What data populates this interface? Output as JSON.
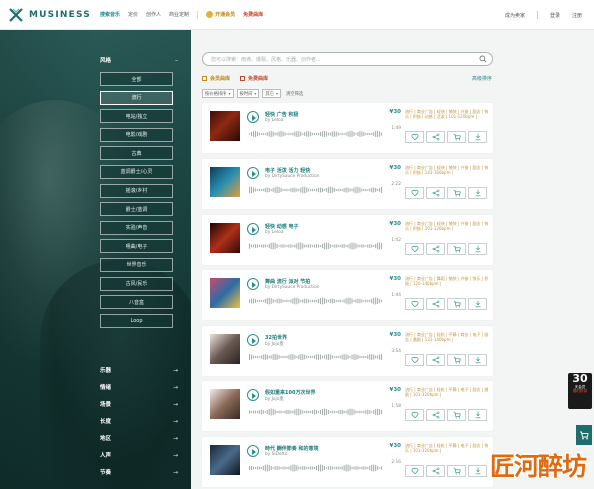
{
  "brand": {
    "name": "MUSINESS",
    "accent": "#1d6e6a"
  },
  "nav": {
    "links": [
      "搜索音乐",
      "定价",
      "创作人",
      "商业定制"
    ],
    "vip": "开通会员",
    "free": "免费曲库",
    "right": [
      "成为卖家",
      "登录",
      "注册"
    ]
  },
  "sidebar": {
    "style_header": "风格",
    "styles": [
      "全部",
      "流行",
      "电站/独立",
      "电影/戏剧",
      "古典",
      "蓝调爵士/心灵",
      "摇滚/乡村",
      "爵士/蓝调",
      "实验/声音",
      "嘻曲/电子",
      "世界音乐",
      "古风/民乐",
      "八音盒",
      "Loop"
    ],
    "selected_style": "流行",
    "categories": [
      "乐器",
      "情绪",
      "场景",
      "长度",
      "地区",
      "人声",
      "节奏"
    ]
  },
  "search": {
    "placeholder": "您可以搜索：雨滴、爆裂、风格、乐器、创作者..."
  },
  "filters": {
    "vip_only": "会员曲库",
    "free_only": "免费曲库",
    "advanced": "高级排序",
    "selects": [
      "按价格排序",
      "按时间",
      "其它"
    ],
    "reset": "清空筛选"
  },
  "tracks": [
    {
      "tags": "轻快 广告 积极",
      "author": "by Letoa",
      "price": "¥30",
      "duration": "1:49",
      "keywords": "流行 | 商业广告 | 轻快 | 愉快 | 兴奋 | 励志 | 快乐 | 积极 | 动感 | 活泼 | 101-120bpm |"
    },
    {
      "tags": "电子 活泼 活力 轻快",
      "author": "by DirtySauce Production",
      "price": "¥30",
      "duration": "2:22",
      "keywords": "流行 | 商业广告 | 轻快 | 愉快 | 兴奋 | 励志 | 快乐 | 积极 | 143-160bpm |"
    },
    {
      "tags": "轻快 动感 电子",
      "author": "by Letoa",
      "price": "¥30",
      "duration": "1:42",
      "keywords": "流行 | 商业广告 | 轻快 | 愉快 | 兴奋 | 励志 | 快乐 | 积极 | 101-120bpm |"
    },
    {
      "tags": "舞曲 流行 派对 节拍",
      "author": "by DirtySauce Production",
      "price": "¥30",
      "duration": "1:44",
      "keywords": "流行 | 商业广告 | 舞蹈 | 愉快 | 兴奋 | 快乐 | 积极 | 120-140bpm |"
    },
    {
      "tags": "32拍世界",
      "author": "by Jojo麦",
      "price": "¥30",
      "duration": "3:54",
      "keywords": "流行 | 商业广告 | 轻松 | 平静 | 商业 | 电子 | 励志 | 激励 | 121-140bpm |"
    },
    {
      "tags": "假如重来100万次世界",
      "author": "by Jojo麦",
      "price": "¥30",
      "duration": "1:58",
      "keywords": "流行 | 商业广告 | 轻松 | 平静 | 电子 | 励志 | 激励 | 101-120bpm |"
    },
    {
      "tags": "時代 鋼伴節奏 和的意境",
      "author": "by SiDotto",
      "price": "¥30",
      "duration": "2:16",
      "keywords": "流行 | 商业广告 | 轻松 | 平静 | 电子 | 励志 | 快乐 | 101-120bpm |"
    }
  ],
  "promo": {
    "big": "30",
    "line1": "天会员",
    "line2": "限时折扣"
  },
  "watermark": "匠河醉坊"
}
